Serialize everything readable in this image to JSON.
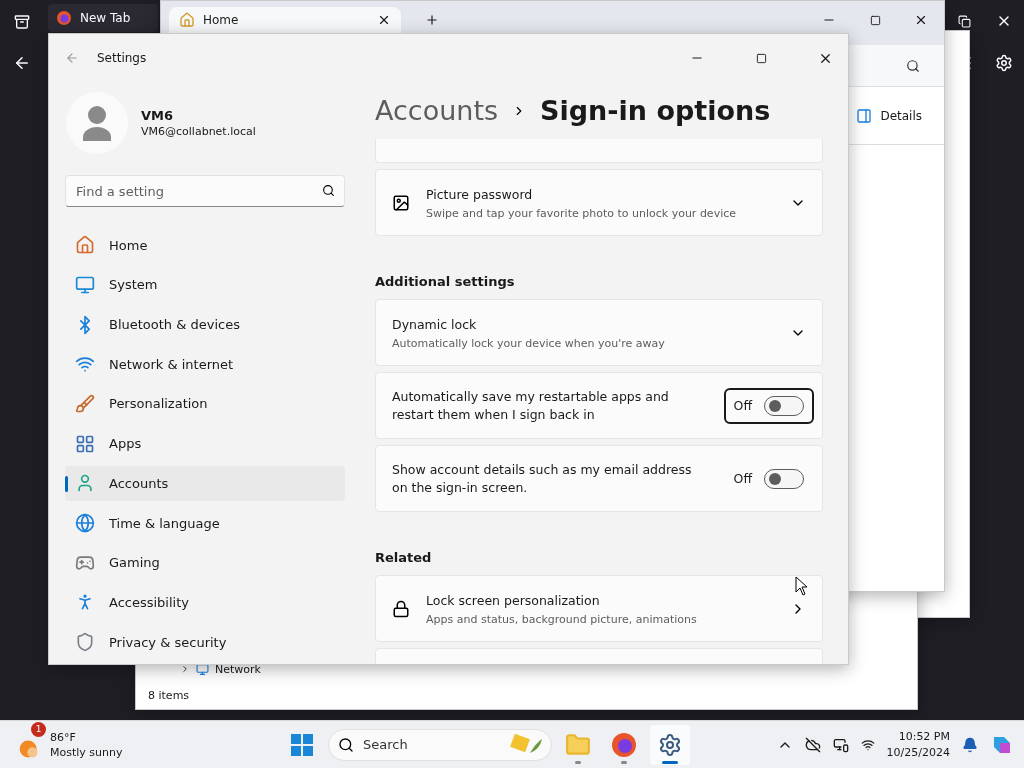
{
  "browser": {
    "tabs": [
      {
        "label": "New Tab",
        "selected": false
      }
    ]
  },
  "explorer": {
    "tabs": [
      {
        "label": "Home",
        "selected": true
      }
    ],
    "details_button": "Details",
    "tree_item": "Network",
    "status_bar": "8 items"
  },
  "settings": {
    "window": {
      "title": "Settings"
    },
    "user": {
      "name": "VM6",
      "email": "VM6@collabnet.local"
    },
    "search": {
      "placeholder": "Find a setting"
    },
    "nav": [
      {
        "label": "Home",
        "selected": false
      },
      {
        "label": "System",
        "selected": false
      },
      {
        "label": "Bluetooth & devices",
        "selected": false
      },
      {
        "label": "Network & internet",
        "selected": false
      },
      {
        "label": "Personalization",
        "selected": false
      },
      {
        "label": "Apps",
        "selected": false
      },
      {
        "label": "Accounts",
        "selected": true
      },
      {
        "label": "Time & language",
        "selected": false
      },
      {
        "label": "Gaming",
        "selected": false
      },
      {
        "label": "Accessibility",
        "selected": false
      },
      {
        "label": "Privacy & security",
        "selected": false
      }
    ],
    "breadcrumb": {
      "parent": "Accounts",
      "current": "Sign-in options"
    },
    "blocks": [
      {
        "kind": "fragment"
      },
      {
        "kind": "expander",
        "title": "Picture password",
        "subtitle": "Swipe and tap your favorite photo to unlock your device"
      },
      {
        "kind": "heading",
        "title": "Additional settings"
      },
      {
        "kind": "expander",
        "title": "Dynamic lock",
        "subtitle": "Automatically lock your device when you're away"
      },
      {
        "kind": "toggle",
        "title": "Automatically save my restartable apps and restart them when I sign back in",
        "state_label": "Off",
        "on": false,
        "focused": true
      },
      {
        "kind": "toggle",
        "title": "Show account details such as my email address on the sign-in screen.",
        "state_label": "Off",
        "on": false,
        "focused": false
      },
      {
        "kind": "heading",
        "title": "Related"
      },
      {
        "kind": "link",
        "title": "Lock screen personalization",
        "subtitle": "Apps and status, background picture, animations"
      },
      {
        "kind": "fragment"
      }
    ]
  },
  "taskbar": {
    "weather": {
      "badge": "1",
      "temperature": "86°F",
      "condition": "Mostly sunny"
    },
    "search": {
      "placeholder": "Search"
    },
    "apps": [
      {
        "running": true,
        "active": false
      },
      {
        "running": true,
        "active": false
      },
      {
        "running": true,
        "active": true
      }
    ],
    "clock": {
      "time": "10:52 PM",
      "date": "10/25/2024"
    }
  }
}
